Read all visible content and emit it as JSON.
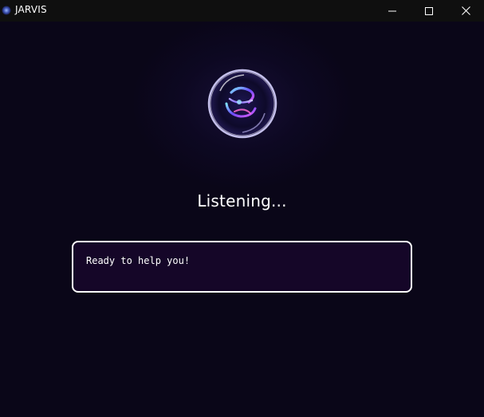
{
  "window": {
    "title": "JARVIS",
    "app_icon": "orb-icon",
    "controls": {
      "minimize_icon": "minimize-icon",
      "maximize_icon": "maximize-icon",
      "close_icon": "close-icon"
    }
  },
  "main": {
    "orb_icon": "energy-orb",
    "status_text": "Listening...",
    "response_text": "Ready to help you!"
  },
  "colors": {
    "background": "#0a0618",
    "titlebar": "#0f0f0f",
    "response_box_bg": "#150628",
    "response_box_border": "#ffffff",
    "text": "#ffffff",
    "orb_accent": "#6a4cff"
  }
}
